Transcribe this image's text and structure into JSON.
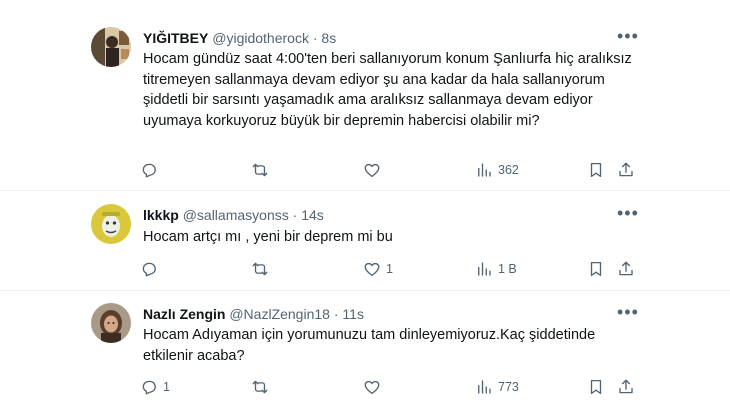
{
  "tweets": [
    {
      "name": "YIĞITBEY",
      "handle": "@yigidotherock",
      "time": "8s",
      "text": "Hocam gündüz saat 4:00'ten beri sallanıyorum konum Şanlıurfa hiç aralıksız titremeyen sallanmaya devam ediyor şu ana kadar da hala sallanıyorum şiddetli bir sarsıntı yaşamadık ama aralıksız sallanmaya devam ediyor uyumaya korkuyoruz büyük bir depremin habercisi olabilir mi?",
      "reply_count": "",
      "retweet_count": "",
      "like_count": "",
      "views": "362"
    },
    {
      "name": "lkkkp",
      "handle": "@sallamasyonss",
      "time": "14s",
      "text": "Hocam artçı mı , yeni bir deprem mi bu",
      "reply_count": "",
      "retweet_count": "",
      "like_count": "1",
      "views": "1 B"
    },
    {
      "name": "Nazlı Zengin",
      "handle": "@NazlZengin18",
      "time": "11s",
      "text": "Hocam Adıyaman için yorumunuzu tam dinleyemiyoruz.Kaç şiddetinde etkilenir acaba?",
      "reply_count": "1",
      "retweet_count": "",
      "like_count": "",
      "views": "773"
    }
  ],
  "separator": "·",
  "more_glyph": "•••",
  "icons": {
    "reply": "reply-icon",
    "retweet": "retweet-icon",
    "like": "heart-icon",
    "views": "views-icon",
    "bookmark": "bookmark-icon",
    "share": "share-icon",
    "more": "more-icon"
  },
  "colors": {
    "text": "#0f1419",
    "secondary": "#536471",
    "border": "#eff3f4"
  }
}
